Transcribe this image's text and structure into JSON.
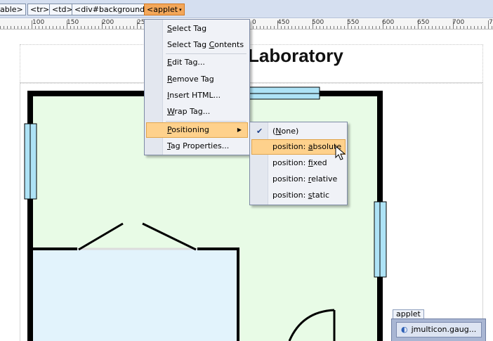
{
  "tag_selector": {
    "crumbs": [
      "able>",
      "<tr>",
      "<td>",
      "<div#background>",
      "<applet"
    ],
    "active_index": 4,
    "active_caret": "▾"
  },
  "ruler": {
    "tick_labels": [
      "100",
      "150",
      "200",
      "25",
      "0",
      "450",
      "500",
      "550",
      "600",
      "650",
      "700",
      "7"
    ]
  },
  "page": {
    "title": "Laboratory"
  },
  "applet": {
    "label": "applet",
    "name": "jmulticon.gaug..."
  },
  "context_menu": {
    "items": [
      {
        "label": "Select Tag",
        "accel_index": 0
      },
      {
        "label": "Select Tag Contents",
        "accel_index": 11
      },
      {
        "label": "Edit Tag...",
        "accel_index": 0
      },
      {
        "label": "Remove Tag",
        "accel_index": 0
      },
      {
        "label": "Insert HTML...",
        "accel_index": 0
      },
      {
        "label": "Wrap Tag...",
        "accel_index": 0
      },
      {
        "label": "Positioning",
        "accel_index": 0,
        "has_submenu": true,
        "highlighted": true
      },
      {
        "label": "Tag Properties...",
        "accel_index": 0
      }
    ]
  },
  "positioning_submenu": {
    "items": [
      {
        "label": "(None)",
        "checked": true,
        "accel_index": 1
      },
      {
        "label": "position: absolute",
        "highlighted": true,
        "accel_index": 10
      },
      {
        "label": "position: fixed",
        "accel_index": 10
      },
      {
        "label": "position: relative",
        "accel_index": 10
      },
      {
        "label": "position: static",
        "accel_index": 10
      }
    ]
  },
  "colors": {
    "floor_fill": "#e8fbe6",
    "room_fill": "#e2f3fc",
    "window_fill": "#aee3f6",
    "wall": "#000000",
    "menu_highlight": "#fed18c",
    "active_tag": "#f3a75a"
  }
}
